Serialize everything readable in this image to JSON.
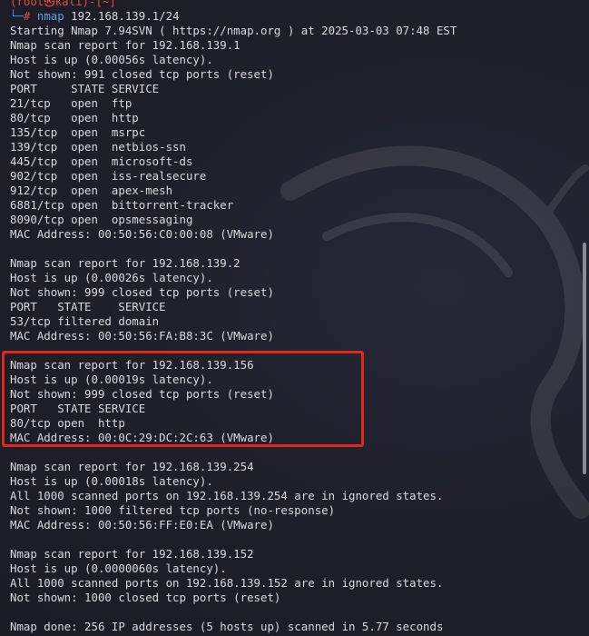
{
  "colors": {
    "background": "#1e1f29",
    "text": "#d9d9de",
    "prompt_blue": "#3a8de0",
    "prompt_red": "#e04a3c",
    "highlight_red": "#e3251c"
  },
  "prompt": {
    "top_text": "(root㉿kali)-[~]",
    "corner": "└─",
    "hash": "#",
    "command": "nmap",
    "argument": "192.168.139.1/24"
  },
  "output": [
    "Starting Nmap 7.94SVN ( https://nmap.org ) at 2025-03-03 07:48 EST",
    "Nmap scan report for 192.168.139.1",
    "Host is up (0.00056s latency).",
    "Not shown: 991 closed tcp ports (reset)",
    "PORT     STATE SERVICE",
    "21/tcp   open  ftp",
    "80/tcp   open  http",
    "135/tcp  open  msrpc",
    "139/tcp  open  netbios-ssn",
    "445/tcp  open  microsoft-ds",
    "902/tcp  open  iss-realsecure",
    "912/tcp  open  apex-mesh",
    "6881/tcp open  bittorrent-tracker",
    "8090/tcp open  opsmessaging",
    "MAC Address: 00:50:56:C0:00:08 (VMware)",
    "",
    "Nmap scan report for 192.168.139.2",
    "Host is up (0.00026s latency).",
    "Not shown: 999 closed tcp ports (reset)",
    "PORT   STATE    SERVICE",
    "53/tcp filtered domain",
    "MAC Address: 00:50:56:FA:B8:3C (VMware)",
    "",
    "Nmap scan report for 192.168.139.156",
    "Host is up (0.00019s latency).",
    "Not shown: 999 closed tcp ports (reset)",
    "PORT   STATE SERVICE",
    "80/tcp open  http",
    "MAC Address: 00:0C:29:DC:2C:63 (VMware)",
    "",
    "Nmap scan report for 192.168.139.254",
    "Host is up (0.00018s latency).",
    "All 1000 scanned ports on 192.168.139.254 are in ignored states.",
    "Not shown: 1000 filtered tcp ports (no-response)",
    "MAC Address: 00:50:56:FF:E0:EA (VMware)",
    "",
    "Nmap scan report for 192.168.139.152",
    "Host is up (0.0000060s latency).",
    "All 1000 scanned ports on 192.168.139.152 are in ignored states.",
    "Not shown: 1000 closed tcp ports (reset)",
    "",
    "Nmap done: 256 IP addresses (5 hosts up) scanned in 5.77 seconds"
  ]
}
